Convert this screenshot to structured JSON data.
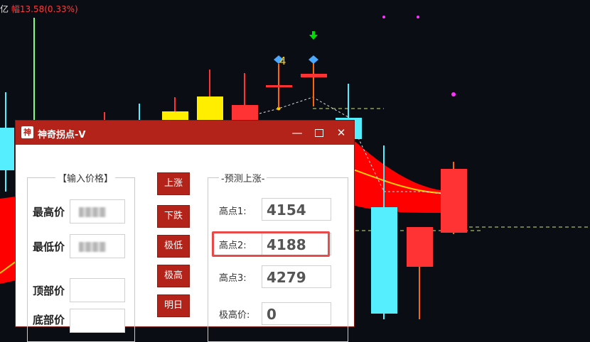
{
  "header": {
    "prefix": "亿",
    "change_label": "幅13.58(0.33%)"
  },
  "chart": {
    "marker_label": "4",
    "colors": {
      "up": "#ff3333",
      "down": "#55eeff",
      "yellow": "#ffee00",
      "bg": "#0b0d14"
    }
  },
  "dialog": {
    "logo_text": "神",
    "title": "神奇拐点-V",
    "controls": {
      "minimize": "—",
      "close": "✕"
    },
    "input_group": {
      "legend": "【输入价格】",
      "fields": [
        {
          "label": "最高价",
          "value": ""
        },
        {
          "label": "最低价",
          "value": ""
        },
        {
          "label": "顶部价",
          "value": ""
        },
        {
          "label": "底部价",
          "value": ""
        }
      ]
    },
    "buttons": [
      "上涨",
      "下跌",
      "极低",
      "极高",
      "明日"
    ],
    "predict_group": {
      "legend": "预测上涨",
      "items": [
        {
          "label": "高点1:",
          "value": "4154"
        },
        {
          "label": "高点2:",
          "value": "4188"
        },
        {
          "label": "高点3:",
          "value": "4279"
        },
        {
          "label": "极高价:",
          "value": "0"
        }
      ]
    }
  }
}
